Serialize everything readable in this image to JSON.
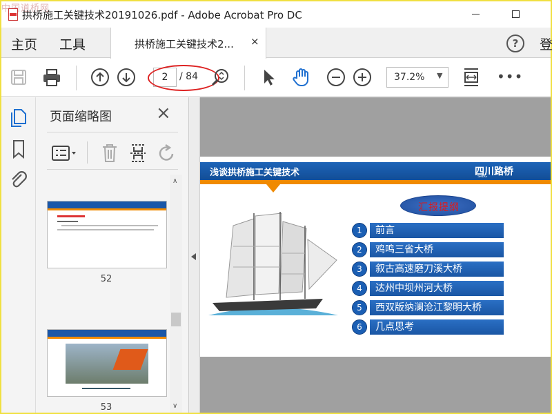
{
  "window": {
    "title": "拱桥施工关键技术20191026.pdf - Adobe Acrobat Pro DC",
    "watermark": "中国道桥网"
  },
  "menubar": {
    "home": "主页",
    "tools": "工具",
    "tab_label": "拱桥施工关键技术2...",
    "tab_close": "×",
    "help": "?",
    "login": "登"
  },
  "toolbar": {
    "current_page": "2",
    "total_pages": "/ 84",
    "zoom": "37.2%",
    "more": "•••",
    "icons": [
      "save-icon",
      "print-icon",
      "prev-page-icon",
      "next-page-icon",
      "zoom-search-icon",
      "select-arrow-icon",
      "hand-tool-icon",
      "zoom-out-icon",
      "zoom-in-icon",
      "fit-page-icon"
    ],
    "highlight_color": "#dd2222"
  },
  "left_rail": {
    "icons": [
      "pages-icon",
      "bookmark-icon",
      "attachment-icon"
    ],
    "active_color": "#1e6fd0"
  },
  "thumbnail_panel": {
    "title": "页面缩略图",
    "close": "×",
    "thumbs": [
      {
        "label": "52"
      },
      {
        "label": "53"
      }
    ]
  },
  "slide": {
    "header_title": "浅谈拱桥施工关键技术",
    "brand": "四川路桥",
    "brand_sub": "SRBG",
    "report_title": "汇报提纲",
    "agenda": [
      {
        "num": "1",
        "text": "前言"
      },
      {
        "num": "2",
        "text": "鸡鸣三省大桥"
      },
      {
        "num": "3",
        "text": "叙古高速磨刀溪大桥"
      },
      {
        "num": "4",
        "text": "达州中坝州河大桥"
      },
      {
        "num": "5",
        "text": "西双版纳澜沧江黎明大桥"
      },
      {
        "num": "6",
        "text": "几点思考"
      }
    ]
  }
}
